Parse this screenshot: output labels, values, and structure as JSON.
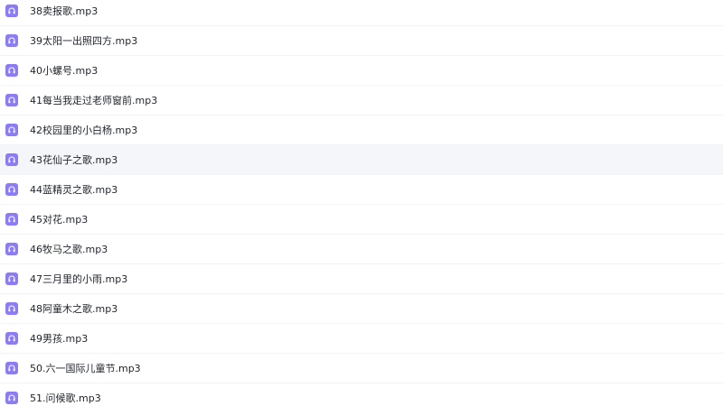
{
  "file_list": {
    "icon_type": "audio-file-icon",
    "icon_color": "#8b7cf6",
    "highlight_color": "#f5f6fa",
    "items": [
      {
        "name": "38卖报歌.mp3"
      },
      {
        "name": "39太阳一出照四方.mp3"
      },
      {
        "name": "40小螺号.mp3"
      },
      {
        "name": "41每当我走过老师窗前.mp3"
      },
      {
        "name": "42校园里的小白杨.mp3"
      },
      {
        "name": "43花仙子之歌.mp3",
        "highlighted": true
      },
      {
        "name": "44蓝精灵之歌.mp3"
      },
      {
        "name": "45对花.mp3"
      },
      {
        "name": "46牧马之歌.mp3"
      },
      {
        "name": "47三月里的小雨.mp3"
      },
      {
        "name": "48阿童木之歌.mp3"
      },
      {
        "name": "49男孩.mp3"
      },
      {
        "name": "50.六一国际儿童节.mp3"
      },
      {
        "name": "51.问候歌.mp3"
      }
    ]
  }
}
